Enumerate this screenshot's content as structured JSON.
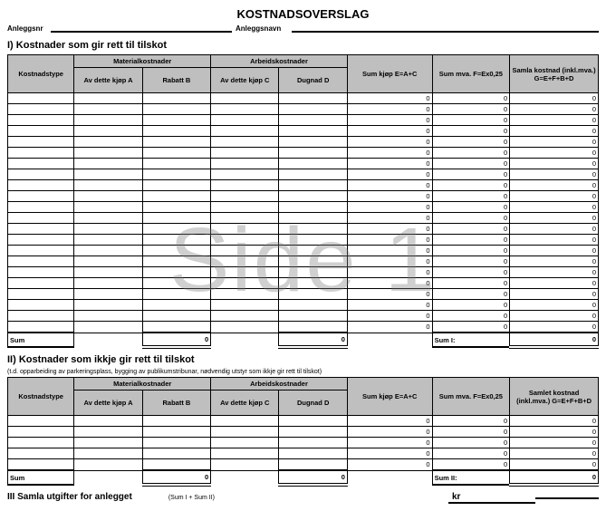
{
  "title": "KOSTNADSOVERSLAG",
  "anleggsnr_label": "Anleggsnr",
  "anleggsnr_value": "",
  "anleggsnavn_label": "Anleggsnavn",
  "anleggsnavn_value": "",
  "watermark": "Side 1",
  "section1": {
    "heading": "I) Kostnader som gir rett til tilskot",
    "headers": {
      "type": "Kostnadstype",
      "material_group": "Materialkostnader",
      "arbeid_group": "Arbeidskostnader",
      "a": "Av dette kjøp A",
      "b": "Rabatt B",
      "c": "Av dette kjøp C",
      "d": "Dugnad D",
      "e": "Sum kjøp E=A+C",
      "f": "Sum mva. F=Ex0,25",
      "g": "Samla kostnad (inkl.mva.) G=E+F+B+D"
    },
    "rows": [
      {
        "type": "",
        "a": "",
        "b": "",
        "c": "",
        "d": "",
        "e": "0",
        "f": "0",
        "g": "0"
      },
      {
        "type": "",
        "a": "",
        "b": "",
        "c": "",
        "d": "",
        "e": "0",
        "f": "0",
        "g": "0"
      },
      {
        "type": "",
        "a": "",
        "b": "",
        "c": "",
        "d": "",
        "e": "0",
        "f": "0",
        "g": "0"
      },
      {
        "type": "",
        "a": "",
        "b": "",
        "c": "",
        "d": "",
        "e": "0",
        "f": "0",
        "g": "0"
      },
      {
        "type": "",
        "a": "",
        "b": "",
        "c": "",
        "d": "",
        "e": "0",
        "f": "0",
        "g": "0"
      },
      {
        "type": "",
        "a": "",
        "b": "",
        "c": "",
        "d": "",
        "e": "0",
        "f": "0",
        "g": "0"
      },
      {
        "type": "",
        "a": "",
        "b": "",
        "c": "",
        "d": "",
        "e": "0",
        "f": "0",
        "g": "0"
      },
      {
        "type": "",
        "a": "",
        "b": "",
        "c": "",
        "d": "",
        "e": "0",
        "f": "0",
        "g": "0"
      },
      {
        "type": "",
        "a": "",
        "b": "",
        "c": "",
        "d": "",
        "e": "0",
        "f": "0",
        "g": "0"
      },
      {
        "type": "",
        "a": "",
        "b": "",
        "c": "",
        "d": "",
        "e": "0",
        "f": "0",
        "g": "0"
      },
      {
        "type": "",
        "a": "",
        "b": "",
        "c": "",
        "d": "",
        "e": "0",
        "f": "0",
        "g": "0"
      },
      {
        "type": "",
        "a": "",
        "b": "",
        "c": "",
        "d": "",
        "e": "0",
        "f": "0",
        "g": "0"
      },
      {
        "type": "",
        "a": "",
        "b": "",
        "c": "",
        "d": "",
        "e": "0",
        "f": "0",
        "g": "0"
      },
      {
        "type": "",
        "a": "",
        "b": "",
        "c": "",
        "d": "",
        "e": "0",
        "f": "0",
        "g": "0"
      },
      {
        "type": "",
        "a": "",
        "b": "",
        "c": "",
        "d": "",
        "e": "0",
        "f": "0",
        "g": "0"
      },
      {
        "type": "",
        "a": "",
        "b": "",
        "c": "",
        "d": "",
        "e": "0",
        "f": "0",
        "g": "0"
      },
      {
        "type": "",
        "a": "",
        "b": "",
        "c": "",
        "d": "",
        "e": "0",
        "f": "0",
        "g": "0"
      },
      {
        "type": "",
        "a": "",
        "b": "",
        "c": "",
        "d": "",
        "e": "0",
        "f": "0",
        "g": "0"
      },
      {
        "type": "",
        "a": "",
        "b": "",
        "c": "",
        "d": "",
        "e": "0",
        "f": "0",
        "g": "0"
      },
      {
        "type": "",
        "a": "",
        "b": "",
        "c": "",
        "d": "",
        "e": "0",
        "f": "0",
        "g": "0"
      },
      {
        "type": "",
        "a": "",
        "b": "",
        "c": "",
        "d": "",
        "e": "0",
        "f": "0",
        "g": "0"
      },
      {
        "type": "",
        "a": "",
        "b": "",
        "c": "",
        "d": "",
        "e": "0",
        "f": "0",
        "g": "0"
      }
    ],
    "sum_label": "Sum",
    "sum_label_right": "Sum I:",
    "sum_b": "0",
    "sum_d": "0",
    "sum_g": "0"
  },
  "section2": {
    "heading": "II) Kostnader som ikkje gir rett til tilskot",
    "subnote": "(t.d. opparbeiding av parkeringsplass, bygging av publikumstribunar, nødvendig utstyr som ikkje gir rett til tilskot)",
    "headers": {
      "type": "Kostnadstype",
      "material_group": "Materialkostnader",
      "arbeid_group": "Arbeidskostnader",
      "a": "Av dette kjøp A",
      "b": "Rabatt B",
      "c": "Av dette kjøp C",
      "d": "Dugnad D",
      "e": "Sum kjøp E=A+C",
      "f": "Sum mva. F=Ex0,25",
      "g": "Samlet kostnad (inkl.mva.) G=E+F+B+D"
    },
    "rows": [
      {
        "type": "",
        "a": "",
        "b": "",
        "c": "",
        "d": "",
        "e": "0",
        "f": "0",
        "g": "0"
      },
      {
        "type": "",
        "a": "",
        "b": "",
        "c": "",
        "d": "",
        "e": "0",
        "f": "0",
        "g": "0"
      },
      {
        "type": "",
        "a": "",
        "b": "",
        "c": "",
        "d": "",
        "e": "0",
        "f": "0",
        "g": "0"
      },
      {
        "type": "",
        "a": "",
        "b": "",
        "c": "",
        "d": "",
        "e": "0",
        "f": "0",
        "g": "0"
      },
      {
        "type": "",
        "a": "",
        "b": "",
        "c": "",
        "d": "",
        "e": "0",
        "f": "0",
        "g": "0"
      }
    ],
    "sum_label": "Sum",
    "sum_label_right": "Sum II:",
    "sum_b": "0",
    "sum_d": "0",
    "sum_g": "0"
  },
  "section3": {
    "heading": "III Samla utgifter for anlegget",
    "note": "(Sum I + Sum II)",
    "kr_label": "kr",
    "amount": ""
  }
}
